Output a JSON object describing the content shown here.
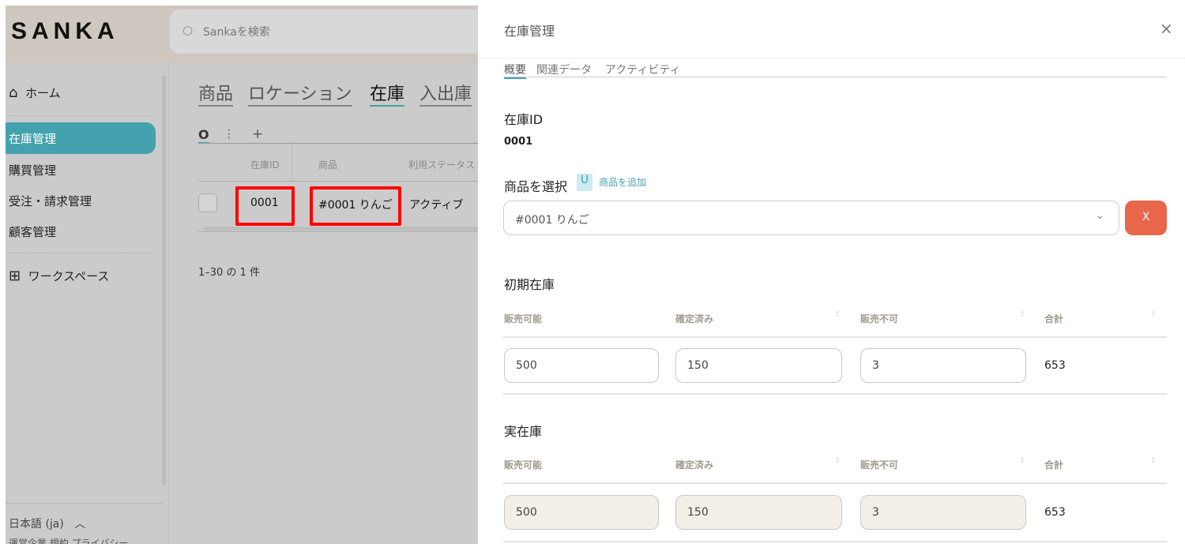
{
  "app": {
    "logo": "SANKA",
    "search_placeholder": "Sankaを検索"
  },
  "sidebar": {
    "items": [
      {
        "label": "ホーム",
        "icon": "home-icon"
      },
      {
        "label": "在庫管理"
      },
      {
        "label": "購買管理"
      },
      {
        "label": "受注・請求管理"
      },
      {
        "label": "顧客管理"
      },
      {
        "label": "ワークスペース",
        "icon": "grid-plus-icon"
      }
    ],
    "language": "日本語 (ja)",
    "footer_links": "運営企業 規約 プライバシー"
  },
  "main": {
    "tabs": [
      "商品",
      "ロケーション",
      "在庫",
      "入出庫"
    ],
    "active_tab": "在庫",
    "add": "+",
    "columns": [
      "在庫ID",
      "商品",
      "利用ステータス"
    ],
    "rows": [
      {
        "id": "0001",
        "product": "#0001 りんご",
        "status": "アクティブ"
      }
    ],
    "pagination": "1–30 の 1 件"
  },
  "drawer": {
    "title": "在庫管理",
    "close": "×",
    "tabs": [
      "概要",
      "関連データ",
      "アクティビティ"
    ],
    "id_label": "在庫ID",
    "id_value": "0001",
    "product_label": "商品を選択",
    "add_product": "商品を追加",
    "product_value": "#0001 りんご",
    "clear_btn": "X",
    "initial": {
      "title": "初期在庫",
      "cols": [
        "販売可能",
        "確定済み",
        "販売不可",
        "合計"
      ],
      "values": [
        "500",
        "150",
        "3"
      ],
      "total": "653"
    },
    "actual": {
      "title": "実在庫",
      "cols": [
        "販売可能",
        "確定済み",
        "販売不可",
        "合計"
      ],
      "values": [
        "500",
        "150",
        "3"
      ],
      "total": "653"
    }
  },
  "colors": {
    "accent": "#44a2ae",
    "danger": "#e8664a",
    "highlight": "#ff0000"
  }
}
